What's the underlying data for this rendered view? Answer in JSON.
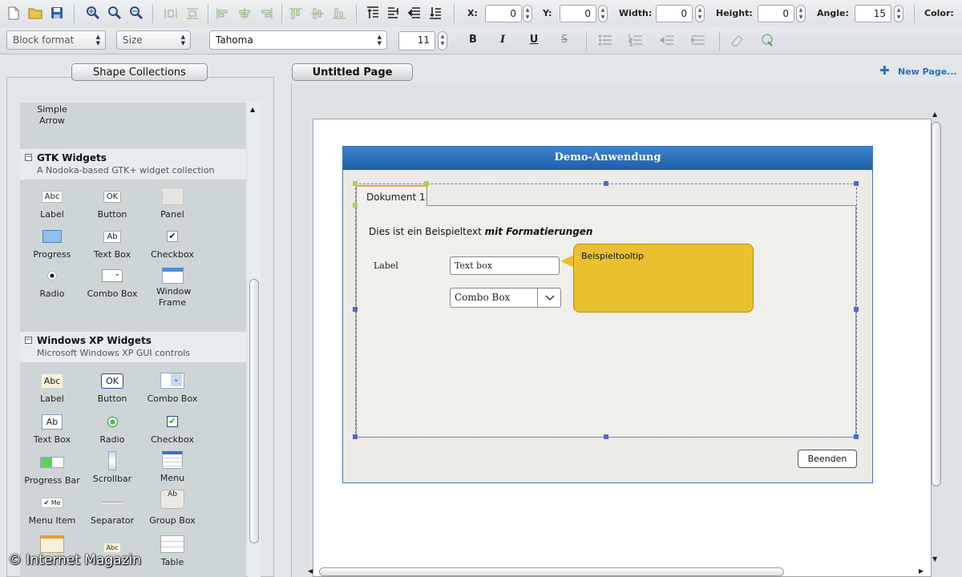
{
  "toolbar": {
    "fields": {
      "x_label": "X:",
      "x_value": "0",
      "y_label": "Y:",
      "y_value": "0",
      "width_label": "Width:",
      "width_value": "0",
      "height_label": "Height:",
      "height_value": "0",
      "angle_label": "Angle:",
      "angle_value": "15",
      "color_label": "Color:"
    },
    "block_format": "Block format",
    "size": "Size",
    "font": "Tahoma",
    "font_size": "11",
    "bold": "B",
    "italic": "I",
    "underline": "U",
    "strike": "S"
  },
  "left_panel": {
    "tab_label": "Shape Collections",
    "partial_item": "Simple\nArrow",
    "groups": [
      {
        "title": "GTK Widgets",
        "subtitle": "A Nodoka-based GTK+ widget collection",
        "items": [
          "Label",
          "Button",
          "Panel",
          "Progress",
          "Text Box",
          "Checkbox",
          "Radio",
          "Combo Box",
          "Window Frame"
        ]
      },
      {
        "title": "Windows XP Widgets",
        "subtitle": "Microsoft Windows XP GUI controls",
        "items": [
          "Label",
          "Button",
          "Combo Box",
          "Text Box",
          "Radio",
          "Checkbox",
          "Progress Bar",
          "Scrollbar",
          "Menu",
          "Menu Item",
          "Separator",
          "Group Box",
          "",
          "",
          "Table"
        ]
      }
    ],
    "icon_texts": {
      "abc": "Abc",
      "ok": "OK",
      "ab": "Ab",
      "me": "Me"
    }
  },
  "page": {
    "tab_label": "Untitled Page",
    "new_page": "New Page..."
  },
  "demo_window": {
    "title": "Demo-Anwendung",
    "tab": "Dokument 1",
    "sample_text": "Dies ist ein Beispieltext ",
    "sample_emph": "mit Formatierungen",
    "label": "Label",
    "textbox": "Text box",
    "combobox": "Combo Box",
    "tooltip": "Beispieltooltip",
    "close_button": "Beenden"
  },
  "watermark": "© Internet Magazin",
  "colors": {
    "accent": "#2c6fbf",
    "window_title": "#1d5ea8",
    "tooltip": "#e9c12e",
    "selection": "#5566cc"
  }
}
